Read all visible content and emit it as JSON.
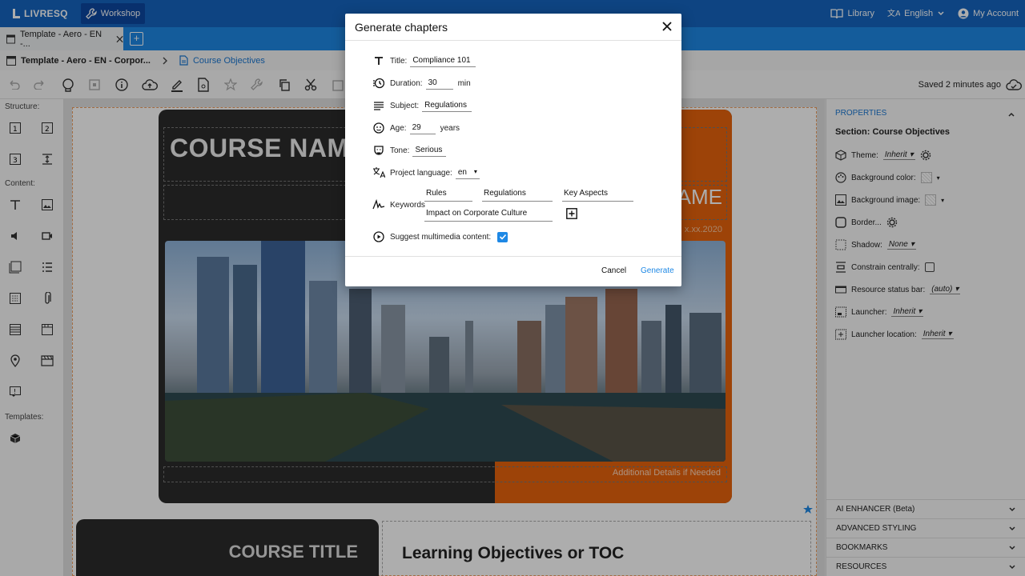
{
  "app": {
    "logo": "LIVRESQ",
    "workshop_label": "Workshop"
  },
  "top_right": {
    "library": "Library",
    "language": "English",
    "account": "My Account"
  },
  "tab": {
    "label": "Template - Aero - EN -..."
  },
  "breadcrumb": {
    "root": "Template - Aero - EN - Corpor...",
    "current": "Course Objectives"
  },
  "toolbar": {
    "saved_status": "Saved 2 minutes ago"
  },
  "left": {
    "structure": "Structure:",
    "content": "Content:",
    "templates": "Templates:"
  },
  "canvas": {
    "course_name": "COURSE NAM",
    "ame": "AME",
    "date": "x.xx.2020",
    "additional": "Additional Details if Needed",
    "course_title": "COURSE TITLE",
    "learning_objectives": "Learning Objectives or TOC"
  },
  "properties": {
    "header": "PROPERTIES",
    "section_title": "Section: Course Objectives",
    "theme_label": "Theme:",
    "theme_value": "Inherit",
    "bg_color_label": "Background color:",
    "bg_image_label": "Background image:",
    "border_label": "Border...",
    "shadow_label": "Shadow:",
    "shadow_value": "None",
    "constrain_label": "Constrain centrally:",
    "status_bar_label": "Resource status bar:",
    "status_bar_value": "(auto)",
    "launcher_label": "Launcher:",
    "launcher_value": "Inherit",
    "launcher_loc_label": "Launcher location:",
    "launcher_loc_value": "Inherit"
  },
  "accordions": [
    "AI ENHANCER (Beta)",
    "ADVANCED STYLING",
    "BOOKMARKS",
    "RESOURCES"
  ],
  "dialog": {
    "title": "Generate chapters",
    "title_label": "Title:",
    "title_value": "Compliance 101",
    "duration_label": "Duration:",
    "duration_value": "30",
    "duration_unit": "min",
    "subject_label": "Subject:",
    "subject_value": "Regulations",
    "age_label": "Age:",
    "age_value": "29",
    "age_unit": "years",
    "tone_label": "Tone:",
    "tone_value": "Serious",
    "project_lang_label": "Project language:",
    "project_lang_value": "en",
    "keywords_label": "Keywords",
    "keywords": [
      "Rules",
      "Regulations",
      "Key Aspects",
      "Impact on Corporate Culture"
    ],
    "suggest_label": "Suggest multimedia content:",
    "cancel": "Cancel",
    "generate": "Generate"
  },
  "colors": {
    "primary": "#1565c0",
    "tabbar": "#1e88e5",
    "accent_orange": "#e8640c",
    "dark": "#2b2b2b"
  }
}
